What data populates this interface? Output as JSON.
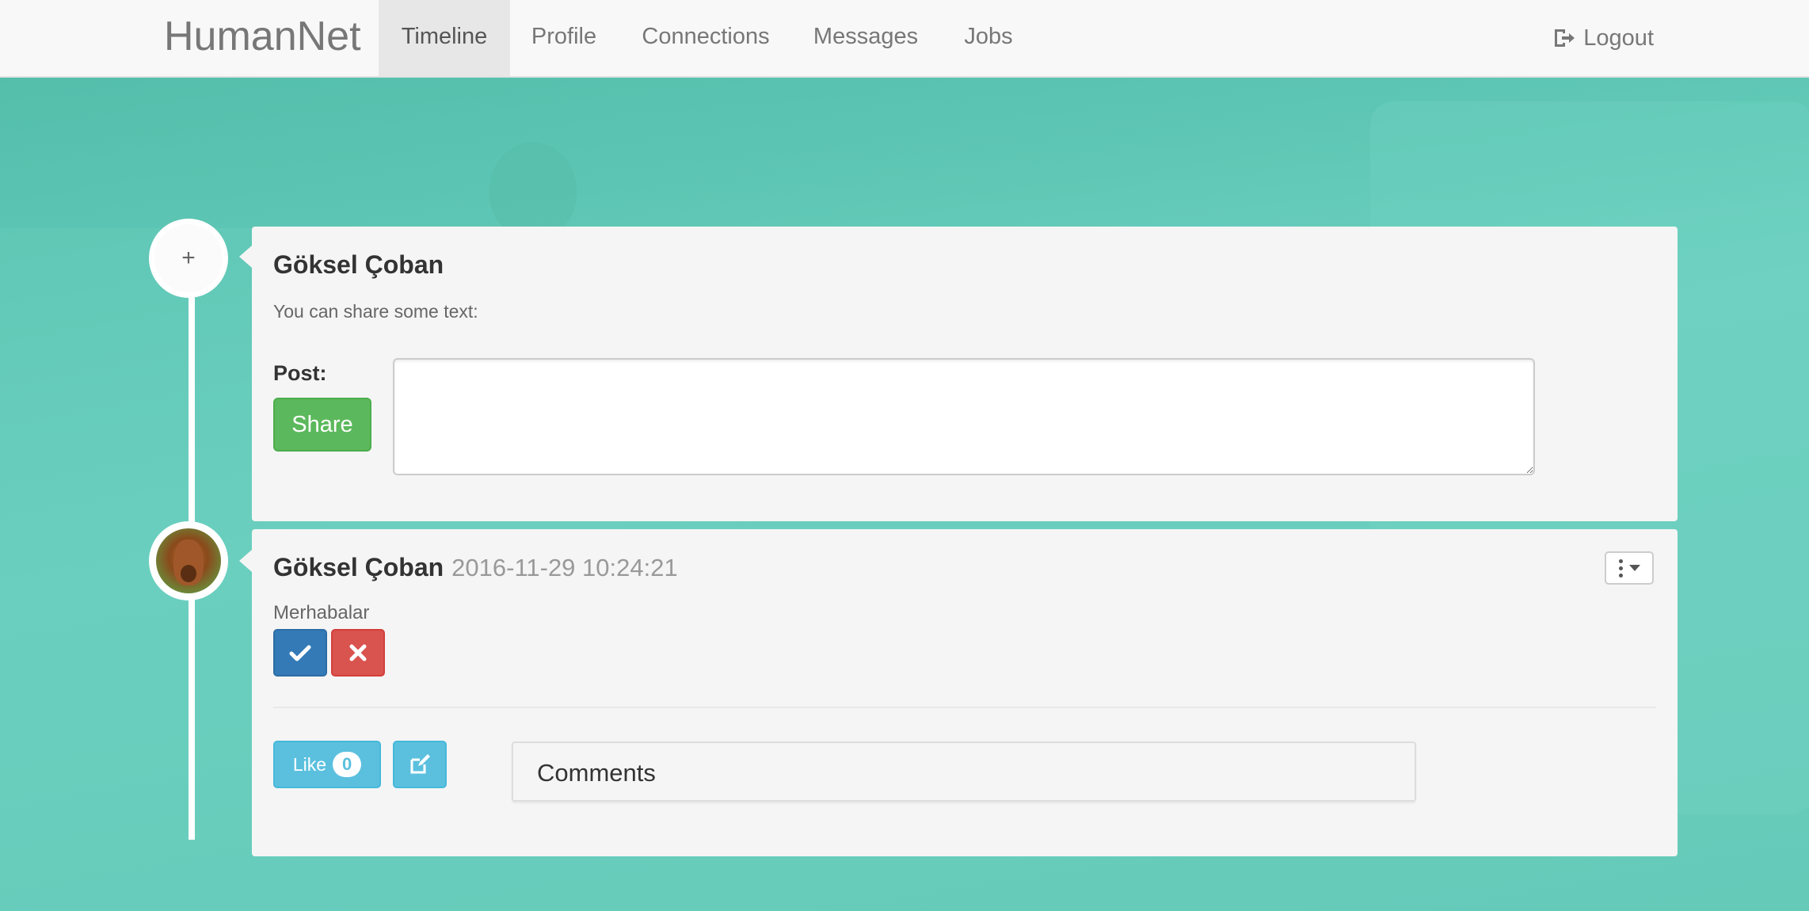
{
  "navbar": {
    "brand": "HumanNet",
    "items": [
      {
        "label": "Timeline",
        "active": true
      },
      {
        "label": "Profile",
        "active": false
      },
      {
        "label": "Connections",
        "active": false
      },
      {
        "label": "Messages",
        "active": false
      },
      {
        "label": "Jobs",
        "active": false
      }
    ],
    "logout_label": "Logout"
  },
  "composer": {
    "name": "Göksel Çoban",
    "hint": "You can share some text:",
    "post_label": "Post:",
    "share_label": "Share",
    "textarea_value": ""
  },
  "post": {
    "author": "Göksel Çoban",
    "timestamp": "2016-11-29 10:24:21",
    "text": "Merhabalar",
    "approve_icon": "check-icon",
    "reject_icon": "times-icon",
    "like_label": "Like",
    "like_count": "0",
    "comments_title": "Comments"
  },
  "colors": {
    "background": "#68cbbb",
    "success": "#5cb85c",
    "primary": "#337ab7",
    "danger": "#d9534f",
    "info": "#5bc0de"
  }
}
